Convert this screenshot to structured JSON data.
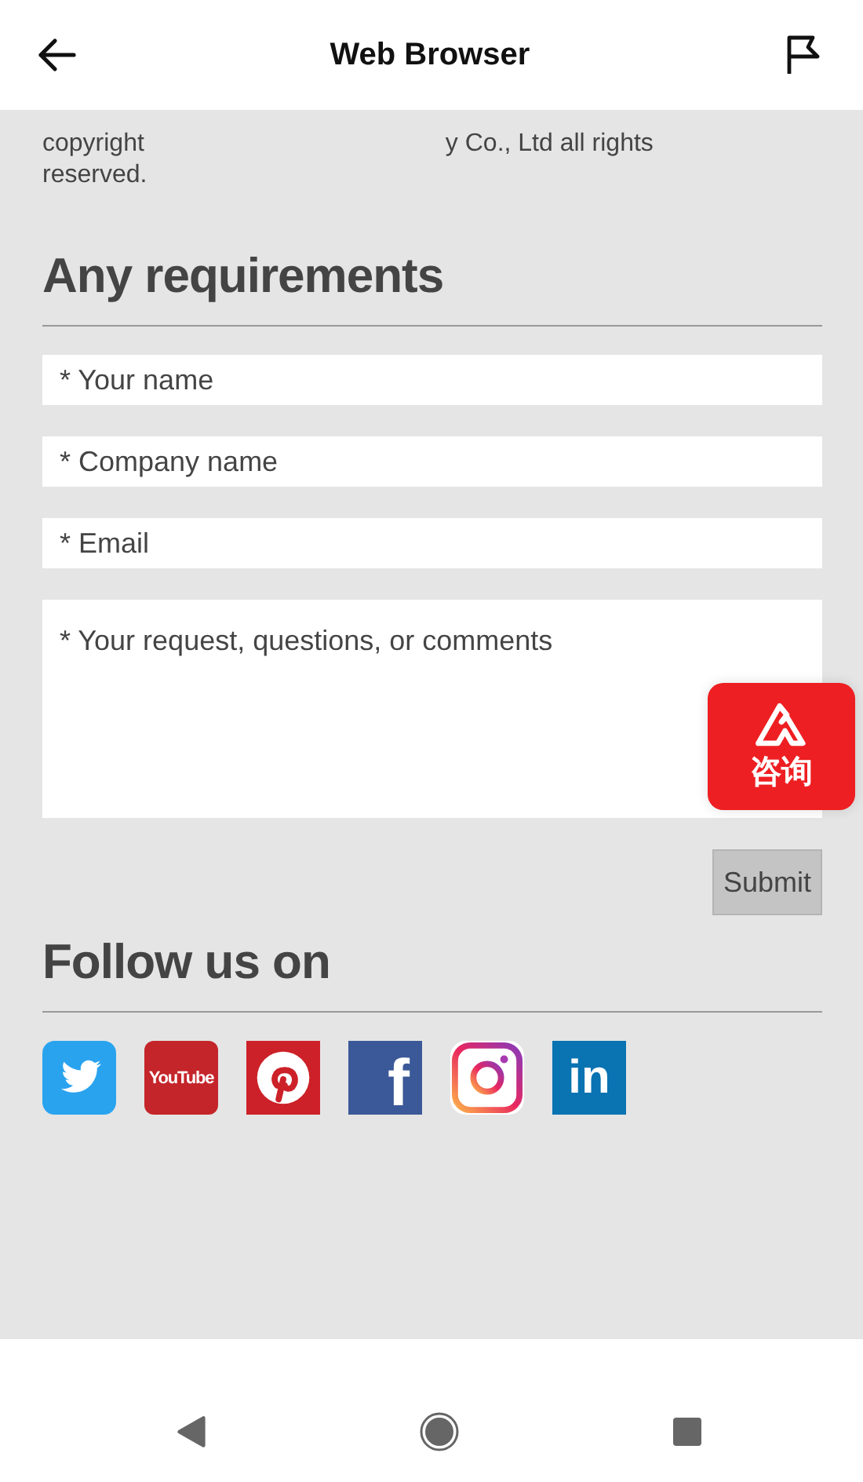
{
  "header": {
    "title": "Web Browser"
  },
  "copyright": {
    "before": "copyright",
    "after": "y Co., Ltd all rights reserved."
  },
  "requirements": {
    "heading": "Any requirements",
    "fields": [
      {
        "kind": "input",
        "placeholder": "* Your name"
      },
      {
        "kind": "input",
        "placeholder": "* Company name"
      },
      {
        "kind": "input",
        "placeholder": "* Email"
      },
      {
        "kind": "textarea",
        "placeholder": "* Your request, questions, or comments"
      }
    ],
    "submit": "Submit"
  },
  "consult": {
    "label": "咨询"
  },
  "follow": {
    "heading": "Follow us on",
    "social": [
      {
        "kind": "twitter"
      },
      {
        "kind": "youtube",
        "text": "YouTube"
      },
      {
        "kind": "pinterest"
      },
      {
        "kind": "facebook",
        "text": "f"
      },
      {
        "kind": "instagram"
      },
      {
        "kind": "linkedin",
        "text": "in"
      }
    ]
  }
}
